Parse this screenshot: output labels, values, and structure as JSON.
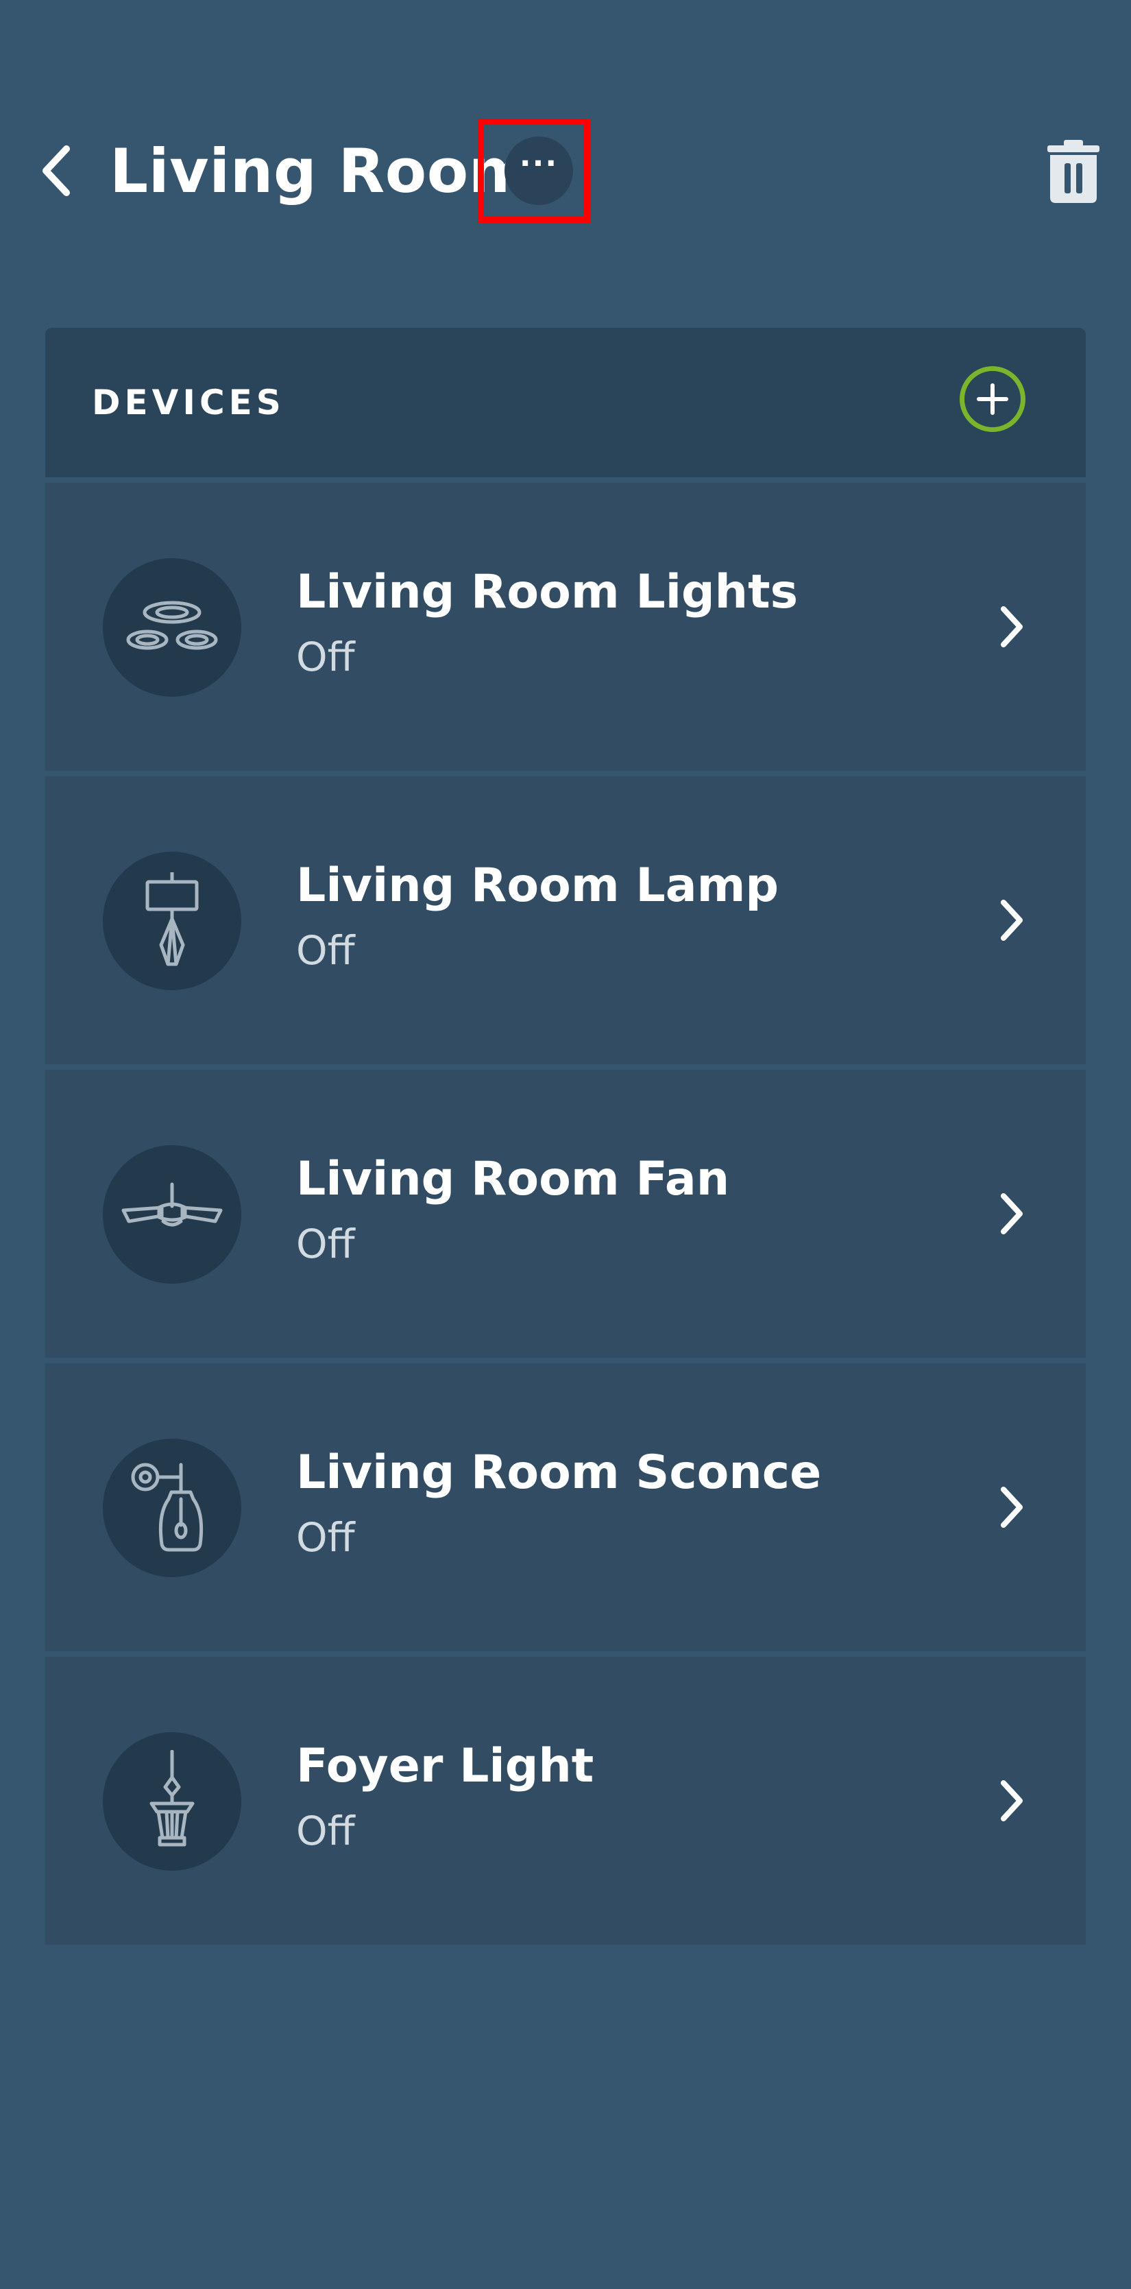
{
  "header": {
    "title": "Living Room",
    "back_icon": "chevron-left-icon",
    "more_label": "···",
    "trash_icon": "trash-icon"
  },
  "devices": {
    "section_title": "DEVICES",
    "add_icon": "plus-circle-icon",
    "accent_color": "#7bb52b",
    "items": [
      {
        "name": "Living Room Lights",
        "status": "Off",
        "icon": "recessed-lights-icon"
      },
      {
        "name": "Living Room Lamp",
        "status": "Off",
        "icon": "table-lamp-icon"
      },
      {
        "name": "Living Room Fan",
        "status": "Off",
        "icon": "ceiling-fan-icon"
      },
      {
        "name": "Living Room Sconce",
        "status": "Off",
        "icon": "wall-sconce-icon"
      },
      {
        "name": "Foyer Light",
        "status": "Off",
        "icon": "pendant-lantern-icon"
      }
    ]
  }
}
